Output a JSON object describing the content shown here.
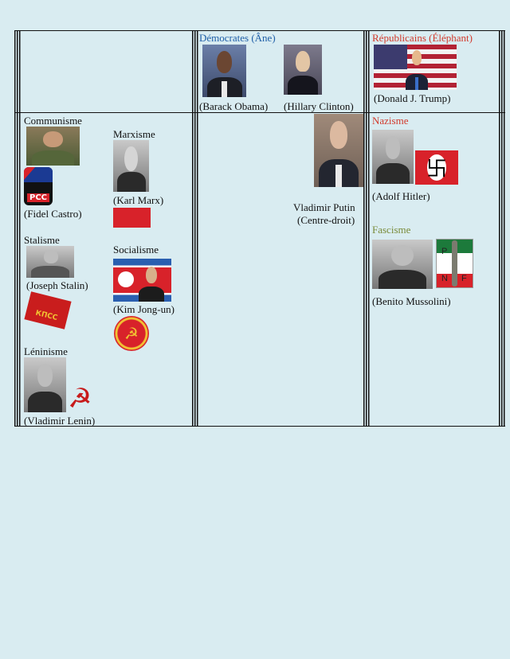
{
  "header": {
    "democrats": "Démocrates (Âne)",
    "republicans": "Républicains (Éléphant)"
  },
  "people": {
    "obama": "(Barack Obama)",
    "clinton": "(Hillary Clinton)",
    "trump": "(Donald J. Trump)",
    "castro": "(Fidel Castro)",
    "marx": "(Karl Marx)",
    "stalin": "(Joseph Stalin)",
    "kim": "(Kim Jong-un)",
    "lenin": "(Vladimir Lenin)",
    "putin_name": "Vladimir Putin",
    "putin_note": "(Centre-droit)",
    "hitler": "(Adolf Hitler)",
    "mussolini": "(Benito Mussolini)"
  },
  "ideologies": {
    "communism": "Communisme",
    "marxism": "Marxisme",
    "stalinism": "Stalisme",
    "socialism": "Socialisme",
    "leninism": "Léninisme",
    "nazism": "Nazisme",
    "fascism": "Fascisme"
  },
  "emblems": {
    "pcc_label": "PCC",
    "kpss_label": "КПСС",
    "nf_top": "P",
    "nf_left": "N",
    "nf_right": "F"
  },
  "colors": {
    "democrat_blue": "#1f5fa8",
    "republican_red": "#d23a2c",
    "fascism_green": "#7a8b3a",
    "background": "#d9ecf1"
  },
  "icons": {
    "swastika": "swastika-icon",
    "hammer_sickle": "hammer-sickle-icon",
    "party_badge": "party-badge-icon"
  }
}
